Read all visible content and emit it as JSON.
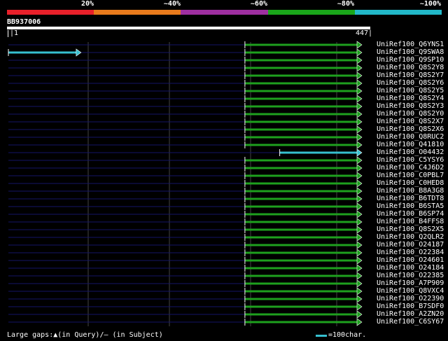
{
  "header": {
    "percent_labels": [
      "20%",
      "~40%",
      "~60%",
      "~80%",
      "~100%"
    ],
    "segment_colors": [
      "#e8202a",
      "#e87a1c",
      "#9e2fa0",
      "#1aa61a",
      "#22b8c8"
    ]
  },
  "query": {
    "name": "BB937006",
    "start": "|1",
    "end": "447|",
    "length": 447
  },
  "colors": {
    "hit_green": "#1ea01e",
    "hit_cyan": "#36c0d0",
    "row_line": "#141466",
    "grid": "#444444"
  },
  "hits": [
    {
      "name": "UniRef100_Q6YNS1",
      "start": 300,
      "end": 447,
      "color": "green"
    },
    {
      "name": "UniRef100_Q9SWA8",
      "start": 1,
      "end": 92,
      "color": "cyan",
      "start2": 300,
      "end2": 447
    },
    {
      "name": "UniRef100_Q9SP10",
      "start": 300,
      "end": 447,
      "color": "green"
    },
    {
      "name": "UniRef100_Q8S2Y8",
      "start": 300,
      "end": 447,
      "color": "green"
    },
    {
      "name": "UniRef100_Q8S2Y7",
      "start": 300,
      "end": 447,
      "color": "green"
    },
    {
      "name": "UniRef100_Q8S2Y6",
      "start": 300,
      "end": 447,
      "color": "green"
    },
    {
      "name": "UniRef100_Q8S2Y5",
      "start": 300,
      "end": 447,
      "color": "green"
    },
    {
      "name": "UniRef100_Q8S2Y4",
      "start": 300,
      "end": 447,
      "color": "green"
    },
    {
      "name": "UniRef100_Q8S2Y3",
      "start": 300,
      "end": 447,
      "color": "green"
    },
    {
      "name": "UniRef100_Q8S2Y0",
      "start": 300,
      "end": 447,
      "color": "green"
    },
    {
      "name": "UniRef100_Q8S2X7",
      "start": 300,
      "end": 447,
      "color": "green"
    },
    {
      "name": "UniRef100_Q8S2X6",
      "start": 300,
      "end": 447,
      "color": "green"
    },
    {
      "name": "UniRef100_Q8RUC2",
      "start": 300,
      "end": 447,
      "color": "green"
    },
    {
      "name": "UniRef100_Q41810",
      "start": 300,
      "end": 447,
      "color": "green"
    },
    {
      "name": "UniRef100_O04432",
      "start": 344,
      "end": 447,
      "color": "cyan"
    },
    {
      "name": "UniRef100_C5YSY6",
      "start": 300,
      "end": 447,
      "color": "green"
    },
    {
      "name": "UniRef100_C4J6D2",
      "start": 300,
      "end": 447,
      "color": "green"
    },
    {
      "name": "UniRef100_C0PBL7",
      "start": 300,
      "end": 447,
      "color": "green"
    },
    {
      "name": "UniRef100_C0HED8",
      "start": 300,
      "end": 447,
      "color": "green"
    },
    {
      "name": "UniRef100_B8A3G8",
      "start": 300,
      "end": 447,
      "color": "green"
    },
    {
      "name": "UniRef100_B6TDT8",
      "start": 300,
      "end": 447,
      "color": "green"
    },
    {
      "name": "UniRef100_B6STA5",
      "start": 300,
      "end": 447,
      "color": "green"
    },
    {
      "name": "UniRef100_B6SP74",
      "start": 300,
      "end": 447,
      "color": "green"
    },
    {
      "name": "UniRef100_B4FFS8",
      "start": 300,
      "end": 447,
      "color": "green"
    },
    {
      "name": "UniRef100_Q8S2X5",
      "start": 300,
      "end": 447,
      "color": "green"
    },
    {
      "name": "UniRef100_Q2QLR2",
      "start": 300,
      "end": 447,
      "color": "green"
    },
    {
      "name": "UniRef100_O24187",
      "start": 300,
      "end": 447,
      "color": "green"
    },
    {
      "name": "UniRef100_O22384",
      "start": 300,
      "end": 447,
      "color": "green"
    },
    {
      "name": "UniRef100_O24601",
      "start": 300,
      "end": 447,
      "color": "green"
    },
    {
      "name": "UniRef100_O24184",
      "start": 300,
      "end": 447,
      "color": "green"
    },
    {
      "name": "UniRef100_O22385",
      "start": 300,
      "end": 447,
      "color": "green"
    },
    {
      "name": "UniRef100_A7P909",
      "start": 300,
      "end": 447,
      "color": "green"
    },
    {
      "name": "UniRef100_Q8VXC4",
      "start": 300,
      "end": 447,
      "color": "green"
    },
    {
      "name": "UniRef100_O22390",
      "start": 300,
      "end": 447,
      "color": "green"
    },
    {
      "name": "UniRef100_B7SDF0",
      "start": 300,
      "end": 447,
      "color": "green"
    },
    {
      "name": "UniRef100_A2ZN20",
      "start": 300,
      "end": 447,
      "color": "green"
    },
    {
      "name": "UniRef100_C6SY67",
      "start": 300,
      "end": 447,
      "color": "green"
    }
  ],
  "footer": {
    "gaps_text": "Large gaps:▲(in Query)/– (in Subject)",
    "scale_text": "=100char."
  }
}
